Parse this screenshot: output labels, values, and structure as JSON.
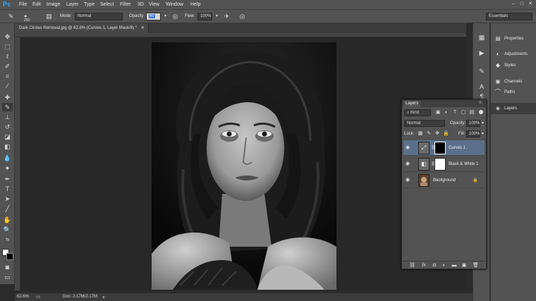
{
  "app": {
    "logo": "Ps"
  },
  "menu": [
    "File",
    "Edit",
    "Image",
    "Layer",
    "Type",
    "Select",
    "Filter",
    "3D",
    "View",
    "Window",
    "Help"
  ],
  "window_controls": {
    "minimize": "–",
    "restore": "□",
    "close": "✕"
  },
  "options": {
    "brush_size": "250",
    "mode_label": "Mode:",
    "mode_value": "Normal",
    "opacity_label": "Opacity:",
    "opacity_value": "60",
    "flow_label": "Flow:",
    "flow_value": "100%",
    "workspace": "Essentials"
  },
  "document": {
    "tab_title": "Dark Circles Removal.jpg @ 62.6% (Curves 1, Layer Mask/8) *",
    "tab_close": "✕"
  },
  "status": {
    "zoom": "62.6%",
    "doc_info": "Doc: 2.17M/2.17M"
  },
  "right_panel": {
    "items": [
      {
        "label": "Properties",
        "icon": "properties-icon"
      },
      {
        "label": "Adjustments",
        "icon": "adjustments-icon"
      },
      {
        "label": "Styles",
        "icon": "styles-icon"
      },
      {
        "label": "Channels",
        "icon": "channels-icon"
      },
      {
        "label": "Paths",
        "icon": "paths-icon"
      },
      {
        "label": "Layers",
        "icon": "layers-icon"
      }
    ]
  },
  "layers_panel": {
    "title": "Layers",
    "filter_kind": "Kind",
    "blend_mode": "Normal",
    "opacity_label": "Opacity:",
    "opacity_value": "100%",
    "lock_label": "Lock:",
    "fill_label": "Fill:",
    "fill_value": "100%",
    "layers": [
      {
        "name": "Curves 1",
        "selected": true
      },
      {
        "name": "Black & White 1",
        "selected": false
      },
      {
        "name": "Background",
        "selected": false
      }
    ]
  },
  "colors": {
    "foreground": "#ffffff",
    "background": "#000000",
    "selection": "#5a6f8a",
    "ps_blue": "#31a8ff"
  }
}
